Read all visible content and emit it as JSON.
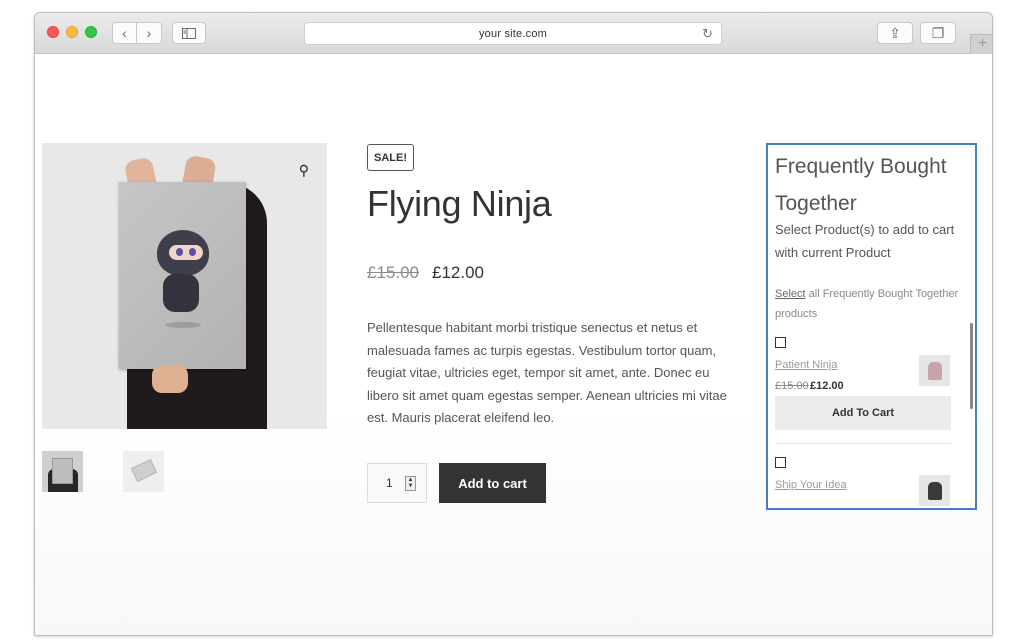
{
  "browser": {
    "url": "your site.com",
    "back_glyph": "‹",
    "forward_glyph": "›",
    "reload_glyph": "↻",
    "share_glyph": "⇪",
    "tabs_glyph": "❐",
    "plus_glyph": "+",
    "icons": [
      "back-icon",
      "forward-icon",
      "sidebar-icon",
      "reload-icon",
      "share-icon",
      "tabs-icon",
      "new-tab-icon"
    ]
  },
  "product": {
    "sale_badge": "SALE!",
    "title": "Flying Ninja",
    "price_old": "£15.00",
    "price_new": "£12.00",
    "description": "Pellentesque habitant morbi tristique senectus et netus et malesuada fames ac turpis egestas. Vestibulum tortor quam, feugiat vitae, ultricies eget, tempor sit amet, ante. Donec eu libero sit amet quam egestas semper. Aenean ultricies mi vitae est. Mauris placerat eleifend leo.",
    "quantity": "1",
    "add_to_cart_label": "Add to cart",
    "zoom_glyph": "⚲"
  },
  "fbt": {
    "title": "Frequently Bought Together",
    "subtitle": "Select Product(s) to add to cart with current Product",
    "select_link": "Select",
    "select_rest": " all Frequently Bought Together products",
    "items": [
      {
        "name": "Patient Ninja",
        "price_old": "£15.00",
        "price_new": "£12.00",
        "button": "Add To Cart",
        "thumb_color": "#c9a3aa"
      },
      {
        "name": "Ship Your Idea",
        "thumb_color": "#3a3a3a"
      }
    ]
  }
}
